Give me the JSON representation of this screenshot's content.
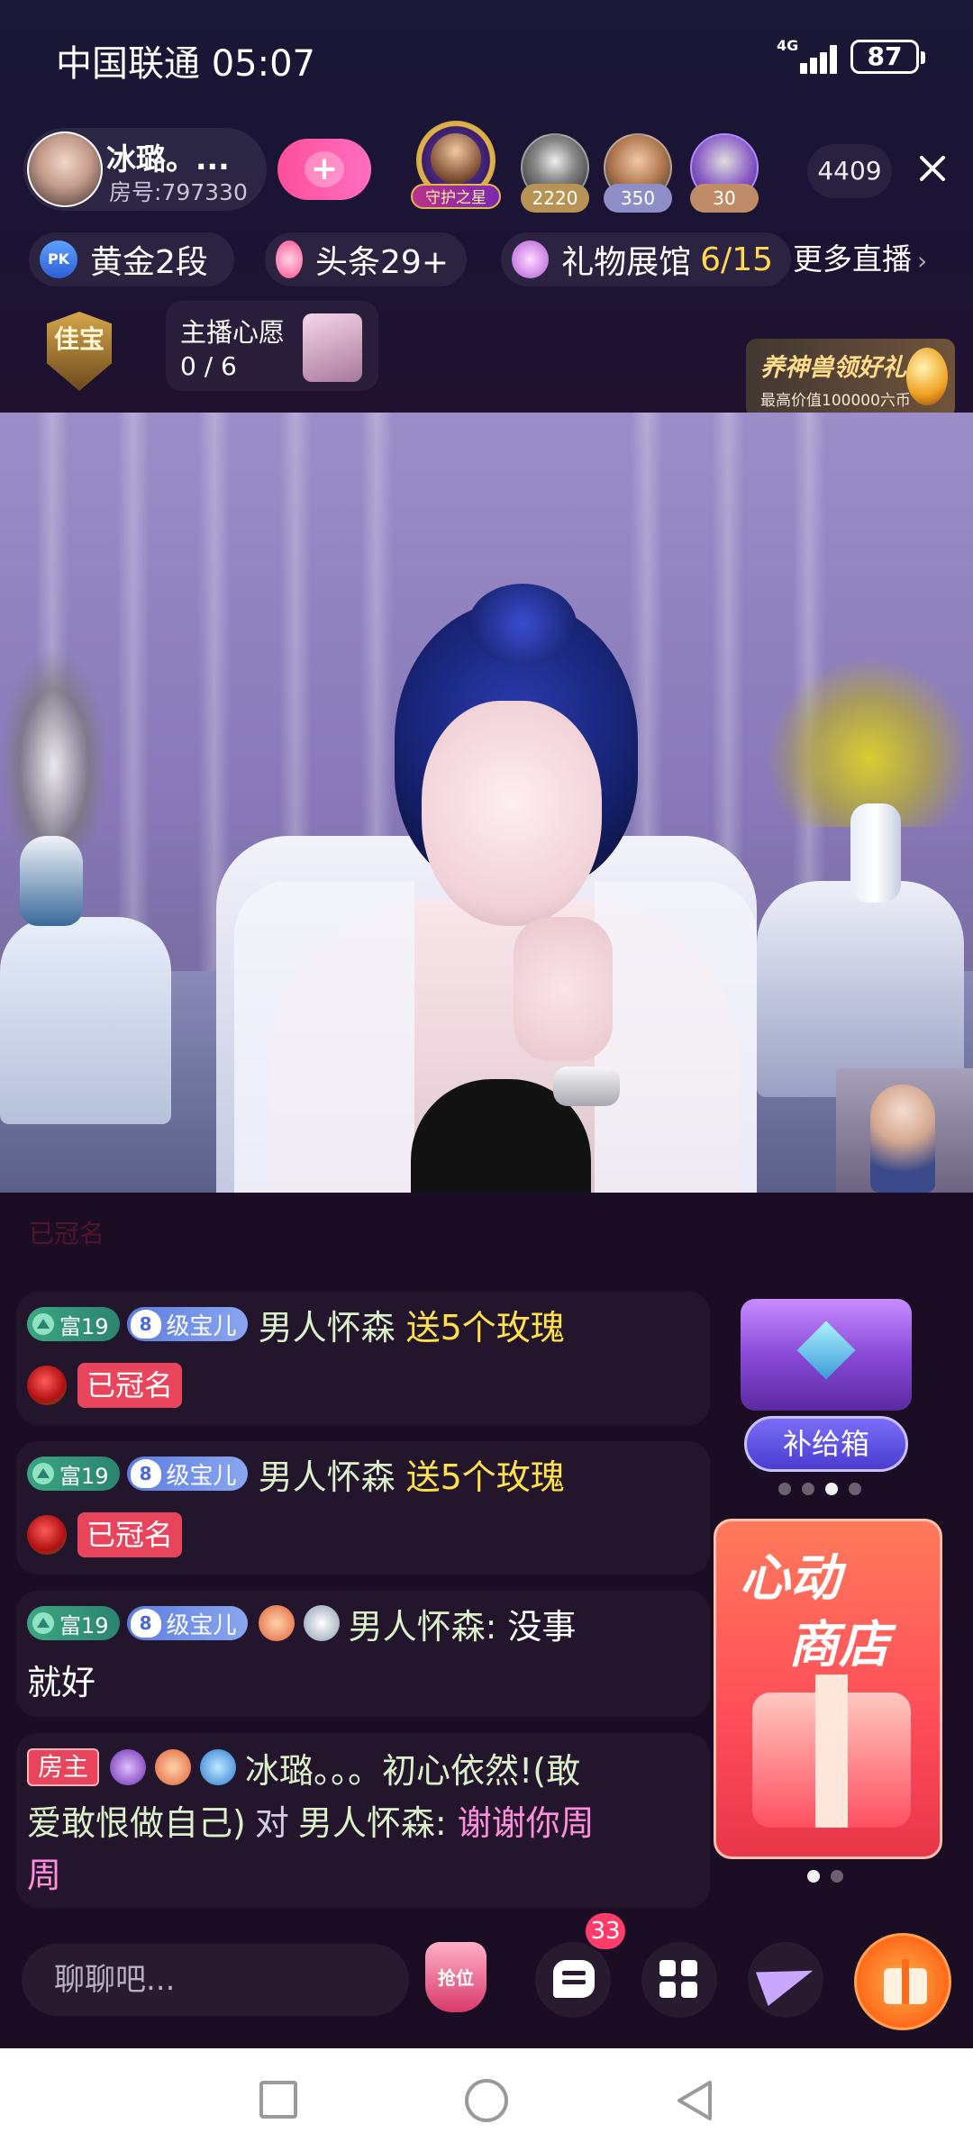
{
  "status_bar": {
    "carrier_time": "中国联通 05:07",
    "network": "4G",
    "battery": "87"
  },
  "host": {
    "name": "冰璐。...",
    "room": "房号:797330"
  },
  "guardian_label": "守护之星",
  "viewers": [
    {
      "badge": "2220"
    },
    {
      "badge": "350"
    },
    {
      "badge": "30"
    }
  ],
  "viewer_count": "4409",
  "tags": {
    "pk_icon": "PK",
    "pk": "黄金2段",
    "headline": "头条29+",
    "gallery": "礼物展馆",
    "gallery_progress": "6/15",
    "more_live": "更多直播"
  },
  "jiabao": "佳宝",
  "wish": {
    "title": "主播心愿",
    "count": "0 / 6"
  },
  "promo": {
    "title": "养神兽领好礼",
    "subtitle": "最高价值100000六币"
  },
  "ghost_text": "已冠名",
  "chat": [
    {
      "fu": "富19",
      "level": "8",
      "bao": "级宝儿",
      "user": "男人怀森",
      "gift": "送5个玫瑰",
      "crowned": "已冠名"
    },
    {
      "fu": "富19",
      "level": "8",
      "bao": "级宝儿",
      "user": "男人怀森",
      "gift": "送5个玫瑰",
      "crowned": "已冠名"
    },
    {
      "fu": "富19",
      "level": "8",
      "bao": "级宝儿",
      "user": "男人怀森:",
      "msg1": "没事",
      "msg2": "就好"
    },
    {
      "role": "房主",
      "host": "冰璐。。。初心依然!(敢",
      "host2": "爱敢恨做自己)",
      "to": "对",
      "user": "男人怀森:",
      "msg1": "谢谢你周",
      "msg2": "周"
    }
  ],
  "supply_box": "补给箱",
  "shop": {
    "line1": "心动",
    "line2": "商店"
  },
  "bottom": {
    "placeholder": "聊聊吧...",
    "seat": "抢位",
    "msg_count": "33"
  },
  "colors": {
    "accent_pink": "#ff4f9a",
    "gift_yellow": "#ffe24a",
    "username_green": "#d9f0c8",
    "reply_pink": "#ff8fdc"
  }
}
